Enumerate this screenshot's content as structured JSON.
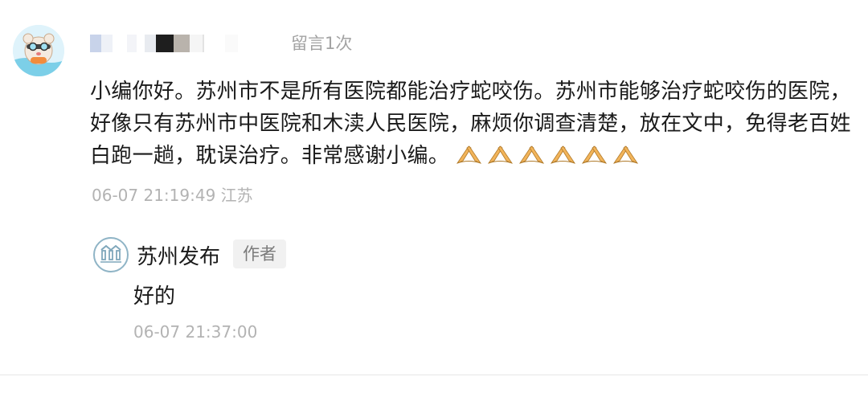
{
  "comment": {
    "nickname_blurred": true,
    "message_count_label": "留言1次",
    "text": "小编你好。苏州市不是所有医院都能治疗蛇咬伤。苏州市能够治疗蛇咬伤的医院，好像只有苏州市中医院和木渎人民医院，麻烦你调查清楚，放在文中，免得老百姓白跑一趟，耽误治疗。非常感谢小编。",
    "emoji": [
      "pray-hands-icon",
      "pray-hands-icon",
      "pray-hands-icon",
      "pray-hands-icon",
      "pray-hands-icon",
      "pray-hands-icon"
    ],
    "datetime": "06-07 21:19:49",
    "location": "江苏"
  },
  "reply": {
    "name": "苏州发布",
    "badge": "作者",
    "text": "好的",
    "datetime": "06-07 21:37:00"
  },
  "colors": {
    "meta_gray": "#b3b3b3",
    "badge_bg": "#f1f1f1",
    "emoji_skin": "#f2b45a"
  }
}
